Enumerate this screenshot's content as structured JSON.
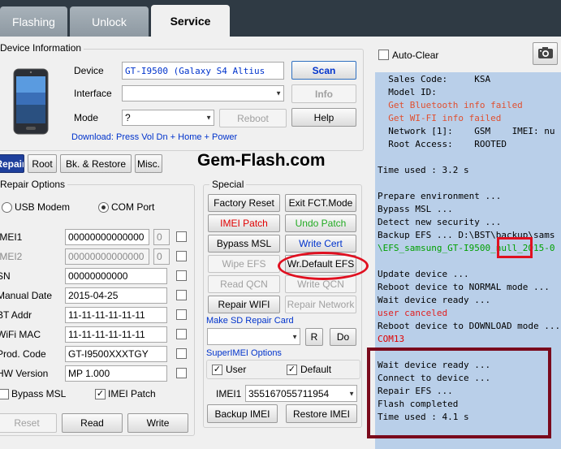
{
  "tabs": [
    {
      "label": "Flashing"
    },
    {
      "label": "Unlock"
    },
    {
      "label": "Service"
    }
  ],
  "device_info": {
    "title": "Device Information",
    "device_label": "Device",
    "device_value": "GT-I9500  (Galaxy S4 Altius",
    "interface_label": "Interface",
    "interface_value": "",
    "mode_label": "Mode",
    "mode_value": "?",
    "scan": "Scan",
    "info": "Info",
    "reboot": "Reboot",
    "help": "Help",
    "download_hint": "Download: Press Vol Dn + Home + Power"
  },
  "sub_tabs": [
    {
      "label": "Repair"
    },
    {
      "label": "Root"
    },
    {
      "label": "Bk. & Restore"
    },
    {
      "label": "Misc."
    }
  ],
  "watermark": "Gem-Flash.com",
  "repair_options": {
    "title": "Repair Options",
    "usb_modem": "USB Modem",
    "com_port": "COM Port",
    "rows": [
      {
        "label": "IMEI1",
        "value": "00000000000000",
        "check": "0"
      },
      {
        "label": "IMEI2",
        "value": "00000000000000",
        "check": "0"
      },
      {
        "label": "SN",
        "value": "00000000000"
      },
      {
        "label": "Manual Date",
        "value": "2015-04-25"
      },
      {
        "label": "BT Addr",
        "value": "11-11-11-11-11-11"
      },
      {
        "label": "WiFi MAC",
        "value": "11-11-11-11-11-11"
      },
      {
        "label": "Prod. Code",
        "value": "GT-I9500XXXTGY"
      },
      {
        "label": "HW Version",
        "value": "MP 1.000"
      }
    ],
    "bypass_msl": "Bypass MSL",
    "imei_patch": "IMEI Patch",
    "reset": "Reset",
    "read": "Read",
    "write": "Write"
  },
  "special": {
    "title": "Special",
    "buttons": [
      {
        "label": "Factory Reset"
      },
      {
        "label": "Exit FCT.Mode"
      },
      {
        "label": "IMEI Patch"
      },
      {
        "label": "Undo Patch"
      },
      {
        "label": "Bypass MSL"
      },
      {
        "label": "Write Cert"
      },
      {
        "label": "Wipe EFS"
      },
      {
        "label": "Wr.Default EFS"
      },
      {
        "label": "Read QCN"
      },
      {
        "label": "Write QCN"
      },
      {
        "label": "Repair WIFI"
      },
      {
        "label": "Repair Network"
      }
    ],
    "sd_label": "Make SD Repair Card",
    "r": "R",
    "do": "Do"
  },
  "super_imei": {
    "title": "SuperIMEI Options",
    "user": "User",
    "default": "Default",
    "imei1_label": "IMEI1",
    "imei1_value": "355167055711954",
    "backup": "Backup IMEI",
    "restore": "Restore IMEI"
  },
  "auto_clear": "Auto-Clear",
  "log": [
    {
      "t": "  Sales Code:     KSA",
      "c": "#000000"
    },
    {
      "t": "  Model ID:",
      "c": "#000000"
    },
    {
      "t": "  Get Bluetooth info failed",
      "c": "#e05030"
    },
    {
      "t": "  Get WI-FI info failed",
      "c": "#e05030"
    },
    {
      "t": "  Network [1]:    GSM    IMEI: nu",
      "c": "#000000"
    },
    {
      "t": "  Root Access:    ROOTED",
      "c": "#000000"
    },
    {
      "t": "",
      "c": "#000000"
    },
    {
      "t": "Time used : 3.2 s",
      "c": "#000000"
    },
    {
      "t": "",
      "c": "#000000"
    },
    {
      "t": "Prepare environment ...",
      "c": "#000000"
    },
    {
      "t": "Bypass MSL ...",
      "c": "#000000"
    },
    {
      "t": "Detect new security ...",
      "c": "#000000"
    },
    {
      "t": "Backup EFS ... D:\\BST\\backup\\sams",
      "c": "#000000"
    },
    {
      "t": "\\EFS_samsung_GT-I9500_null_2015-0",
      "c": "#00a000"
    },
    {
      "t": "",
      "c": "#000000"
    },
    {
      "t": "Update device ...",
      "c": "#000000"
    },
    {
      "t": "Reboot device to NORMAL mode ...",
      "c": "#000000"
    },
    {
      "t": "Wait device ready ...",
      "c": "#000000"
    },
    {
      "t": "user canceled",
      "c": "#e02020"
    },
    {
      "t": "Reboot device to DOWNLOAD mode ...",
      "c": "#000000"
    },
    {
      "t": "COM13",
      "c": "#e00000"
    },
    {
      "t": "",
      "c": "#000000"
    },
    {
      "t": "Wait device ready ...",
      "c": "#000000"
    },
    {
      "t": "Connect to device ...",
      "c": "#000000"
    },
    {
      "t": "Repair EFS ...",
      "c": "#000000"
    },
    {
      "t": "Flash completed",
      "c": "#000000"
    },
    {
      "t": "Time used : 4.1 s",
      "c": "#000000"
    }
  ],
  "colors": {
    "accent": "#0033cc",
    "annotation_red": "#e01020",
    "box_maroon": "#7a0a1c",
    "log_bg": "#b9cfe9"
  }
}
